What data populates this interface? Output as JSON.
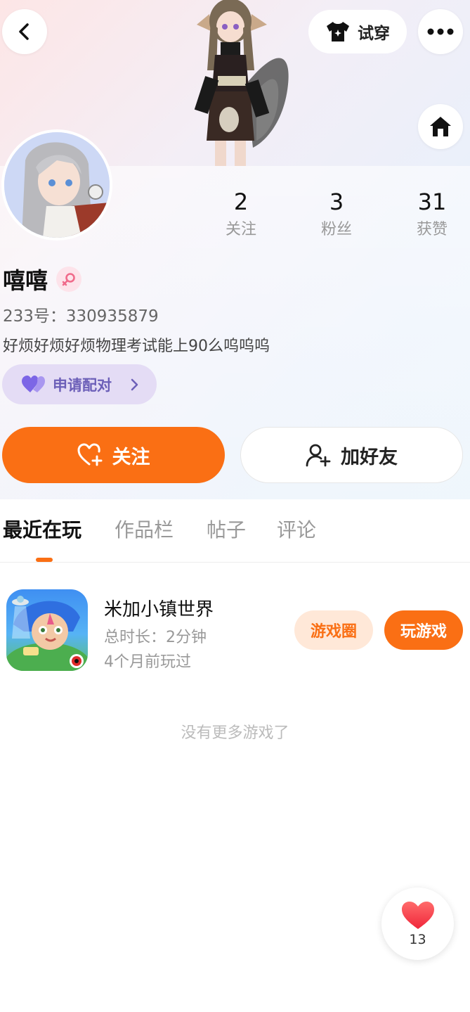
{
  "header": {
    "tryon_label": "试穿",
    "icons": {
      "back": "chevron-left-icon",
      "more": "more-dots-icon",
      "home": "home-icon",
      "tryon": "tshirt-icon"
    }
  },
  "stats": [
    {
      "value": "2",
      "label": "关注"
    },
    {
      "value": "3",
      "label": "粉丝"
    },
    {
      "value": "31",
      "label": "获赞"
    }
  ],
  "profile": {
    "name": "嘻嘻",
    "gender_icon": "female-icon",
    "id_text": "233号：330935879",
    "bio": "好烦好烦好烦物理考试能上90么呜呜呜",
    "pair_label": "申请配对"
  },
  "actions": {
    "follow_label": "关注",
    "add_friend_label": "加好友"
  },
  "tabs": [
    {
      "label": "最近在玩",
      "active": true
    },
    {
      "label": "作品栏",
      "active": false
    },
    {
      "label": "帖子",
      "active": false
    },
    {
      "label": "评论",
      "active": false
    }
  ],
  "games": [
    {
      "title": "米加小镇世界",
      "duration": "总时长：2分钟",
      "last_played": "4个月前玩过",
      "circle_label": "游戏圈",
      "play_label": "玩游戏"
    }
  ],
  "empty_text": "没有更多游戏了",
  "like": {
    "count": "13"
  },
  "colors": {
    "accent": "#fa6f14",
    "pair_bg": "#e4dcf5",
    "pair_text": "#6c5fb8"
  }
}
